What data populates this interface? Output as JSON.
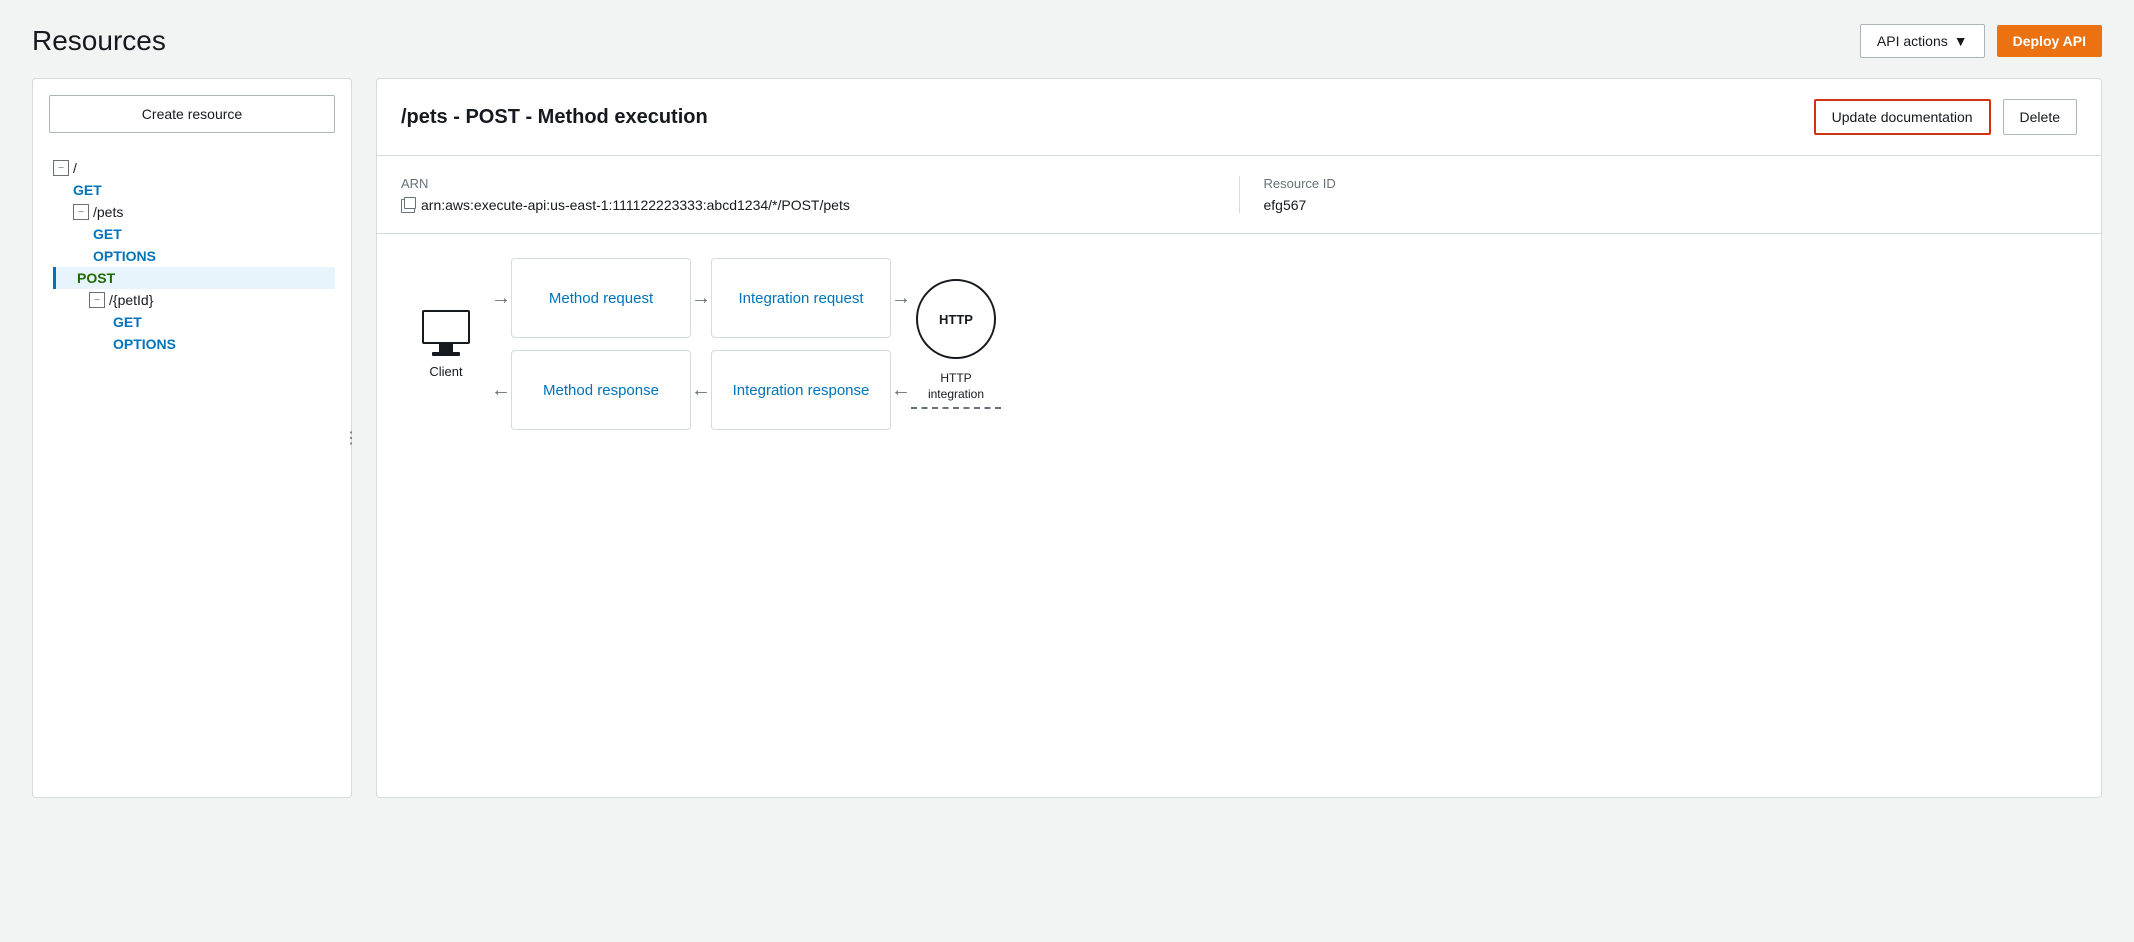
{
  "page": {
    "title": "Resources"
  },
  "header": {
    "api_actions_label": "API actions",
    "deploy_api_label": "Deploy API"
  },
  "left_panel": {
    "create_resource_label": "Create resource",
    "tree": [
      {
        "id": "root",
        "label": "/",
        "type": "root",
        "indent": 0
      },
      {
        "id": "root-get",
        "label": "GET",
        "type": "method",
        "indent": 1
      },
      {
        "id": "pets",
        "label": "/pets",
        "type": "resource",
        "indent": 1
      },
      {
        "id": "pets-get",
        "label": "GET",
        "type": "method",
        "indent": 2
      },
      {
        "id": "pets-options",
        "label": "OPTIONS",
        "type": "method",
        "indent": 2
      },
      {
        "id": "pets-post",
        "label": "POST",
        "type": "method",
        "indent": 2,
        "active": true
      },
      {
        "id": "petid",
        "label": "/{petId}",
        "type": "resource",
        "indent": 2
      },
      {
        "id": "petid-get",
        "label": "GET",
        "type": "method",
        "indent": 3
      },
      {
        "id": "petid-options",
        "label": "OPTIONS",
        "type": "method",
        "indent": 3
      }
    ]
  },
  "right_panel": {
    "method_execution_title": "/pets - POST - Method execution",
    "update_doc_label": "Update documentation",
    "delete_label": "Delete",
    "arn": {
      "label": "ARN",
      "value": "arn:aws:execute-api:us-east-1:111122223333:abcd1234/*/POST/pets"
    },
    "resource_id": {
      "label": "Resource ID",
      "value": "efg567"
    },
    "flow": {
      "client_label": "Client",
      "method_request_label": "Method request",
      "integration_request_label": "Integration request",
      "method_response_label": "Method response",
      "integration_response_label": "Integration response",
      "http_label": "HTTP",
      "http_integration_label": "HTTP integration"
    }
  }
}
